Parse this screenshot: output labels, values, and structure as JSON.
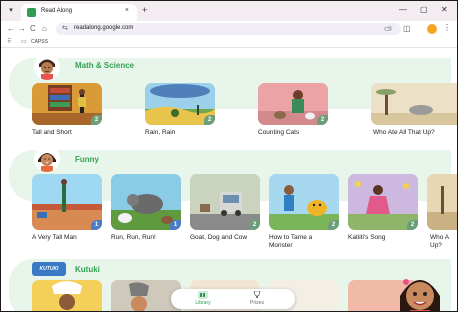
{
  "browser": {
    "tab": {
      "title": "Read Along",
      "close": "×"
    },
    "new_tab": "+",
    "window_controls": {
      "minimize": "—",
      "restore": "▢",
      "close": "✕"
    },
    "nav": {
      "back": "←",
      "forward": "→",
      "reload": "C",
      "home": "⌂"
    },
    "address": {
      "url": "readalong.google.com"
    },
    "bookmarks": {
      "folder_label": "CAPSS"
    },
    "icons": [
      "tab-dropdown-icon",
      "back-icon",
      "forward-icon",
      "reload-icon",
      "home-icon",
      "site-settings-icon",
      "bookmark-star-icon",
      "cast-icon",
      "extensions-icon",
      "profile-icon",
      "menu-kebab-icon",
      "apps-icon",
      "folder-icon"
    ]
  },
  "colors": {
    "accent_green": "#35a153",
    "band_bg": "#e8f5ea",
    "badge_green": "#6b9e79",
    "badge_blue": "#4d7cc7"
  },
  "categories": [
    {
      "title": "Math & Science",
      "books": [
        {
          "label": "Tall and Short",
          "badge": "2",
          "badge_color": "green"
        },
        {
          "label": "Rain, Rain",
          "badge": "2",
          "badge_color": "green"
        },
        {
          "label": "Counting Cats",
          "badge": "2",
          "badge_color": "green"
        },
        {
          "label": "Who Ate All That Up?",
          "badge": "",
          "badge_color": ""
        }
      ]
    },
    {
      "title": "Funny",
      "books": [
        {
          "label": "A Very Tall Man",
          "badge": "1",
          "badge_color": "blue"
        },
        {
          "label": "Run, Run, Run!",
          "badge": "1",
          "badge_color": "blue"
        },
        {
          "label": "Goat, Dog and Cow",
          "badge": "2",
          "badge_color": "green"
        },
        {
          "label": "How to Tame a Monster",
          "badge": "2",
          "badge_color": "green"
        },
        {
          "label": "Katiiti's Song",
          "badge": "2",
          "badge_color": "green"
        },
        {
          "label": "Who A Up?",
          "badge": "",
          "badge_color": ""
        }
      ]
    },
    {
      "title": "Kutuki",
      "logo_text": "KUTUKI",
      "books": []
    }
  ],
  "bottom_nav": {
    "items": [
      {
        "label": "Library",
        "icon": "library-icon",
        "active": true
      },
      {
        "label": "Prizes",
        "icon": "trophy-icon",
        "active": false
      }
    ]
  }
}
